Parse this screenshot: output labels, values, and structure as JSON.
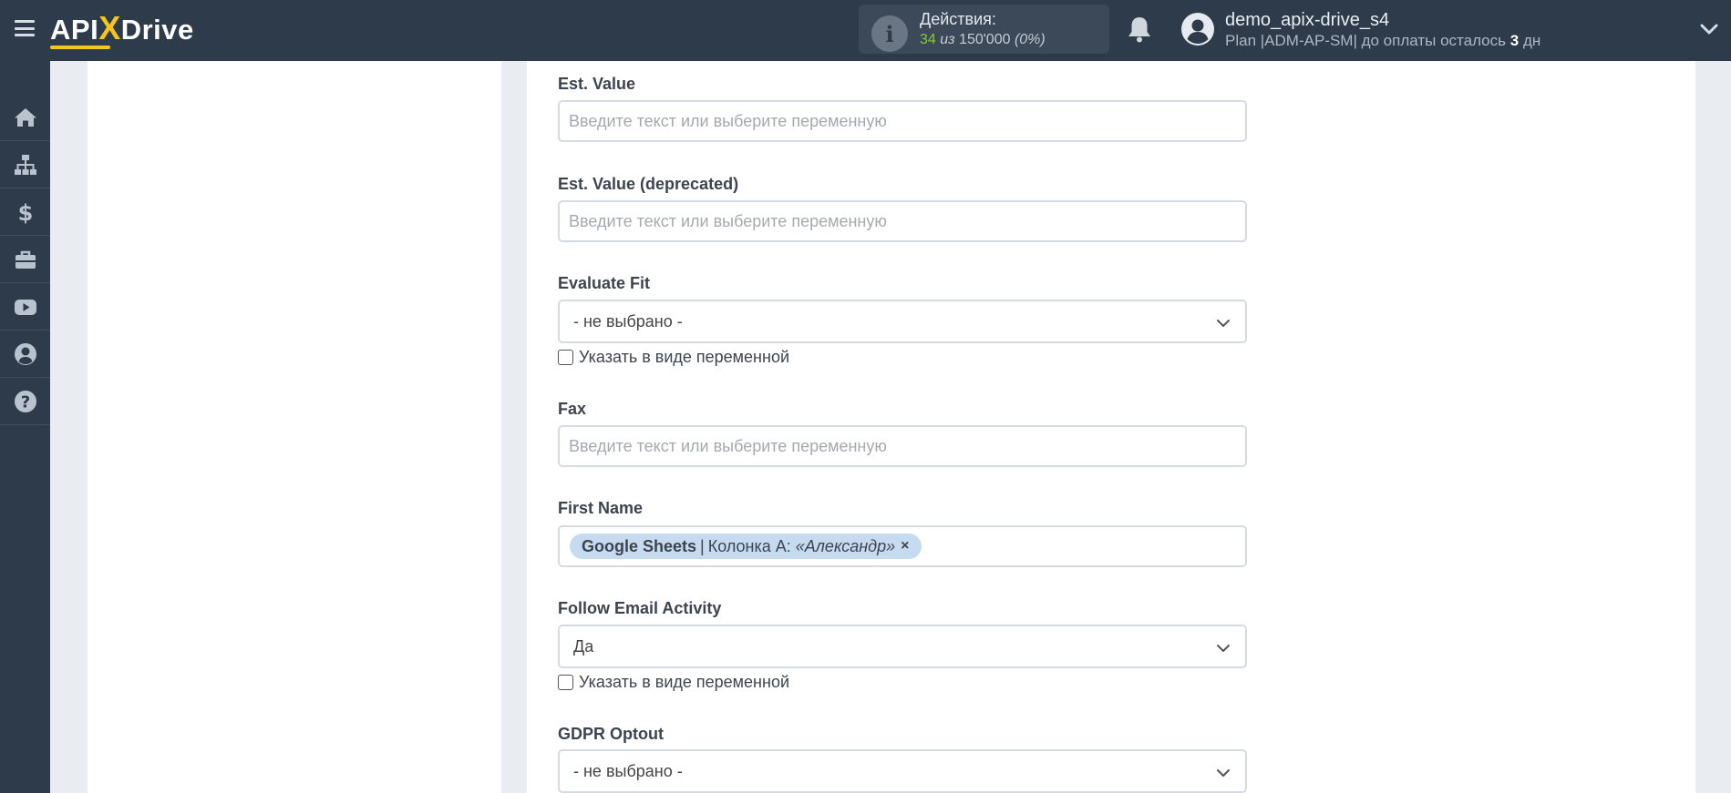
{
  "header": {
    "logo": {
      "pre": "API",
      "x": "X",
      "post": "Drive"
    },
    "actions": {
      "title": "Действия:",
      "used": "34",
      "of_word": "из",
      "limit": "150'000",
      "percent": "(0%)"
    },
    "user": {
      "name": "demo_apix-drive_s4",
      "plan_text": "Plan |ADM-AP-SM| до оплаты осталось",
      "days": "3",
      "days_unit": "дн"
    }
  },
  "sidebar": {
    "items": [
      {
        "icon": "home-icon"
      },
      {
        "icon": "sitemap-icon"
      },
      {
        "icon": "dollar-icon"
      },
      {
        "icon": "briefcase-icon"
      },
      {
        "icon": "youtube-icon"
      },
      {
        "icon": "user-circle-icon"
      },
      {
        "icon": "help-icon"
      }
    ]
  },
  "form": {
    "placeholder": "Введите текст или выберите переменную",
    "checkbox_label": "Указать в виде переменной",
    "fields": {
      "est_value": {
        "label": "Est. Value"
      },
      "est_value_deprecated": {
        "label": "Est. Value (deprecated)"
      },
      "evaluate_fit": {
        "label": "Evaluate Fit",
        "value": "- не выбрано -"
      },
      "fax": {
        "label": "Fax"
      },
      "first_name": {
        "label": "First Name",
        "tag": {
          "source": "Google Sheets",
          "separator": "|",
          "column": "Колонка A:",
          "value": "«Александр»",
          "remove": "×"
        }
      },
      "follow_email_activity": {
        "label": "Follow Email Activity",
        "value": "Да"
      },
      "gdpr_optout": {
        "label": "GDPR Optout",
        "value": "- не выбрано -"
      }
    }
  },
  "colors": {
    "topbar": "#2e3b4a",
    "accent_yellow": "#f5c518",
    "used_green": "#8cc43c",
    "tag_bg": "#c6dbf0"
  }
}
